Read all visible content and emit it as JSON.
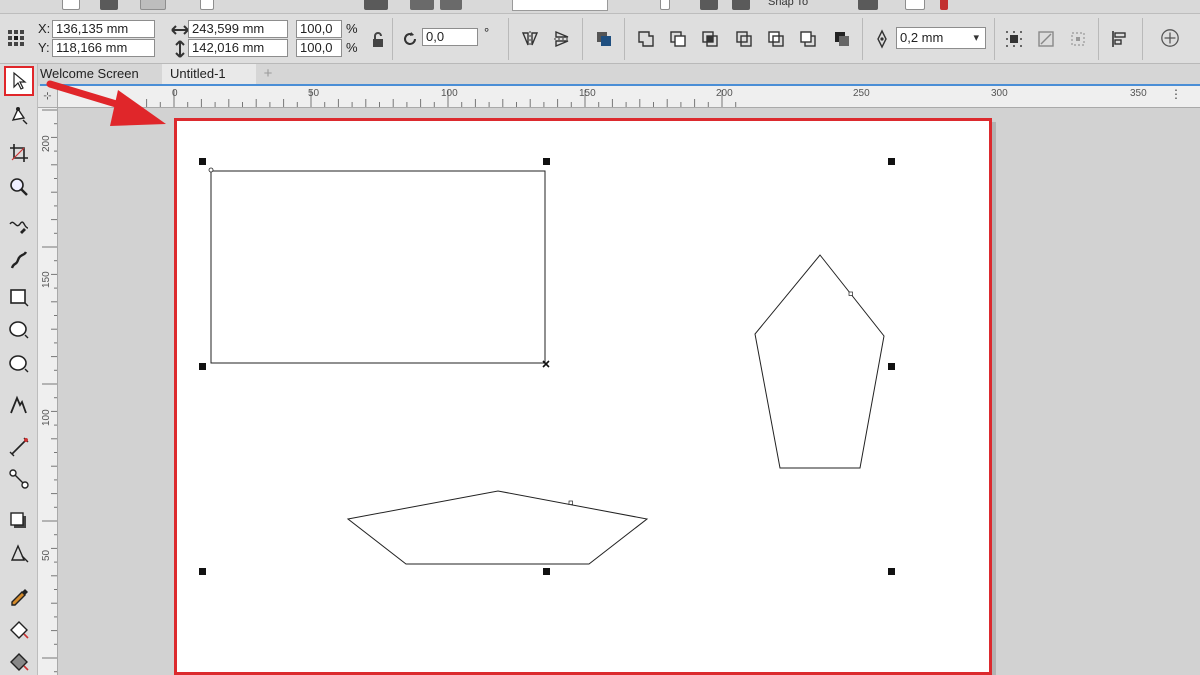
{
  "property_bar": {
    "x_label": "X:",
    "x_value": "136,135 mm",
    "y_label": "Y:",
    "y_value": "118,166 mm",
    "width_value": "243,599 mm",
    "height_value": "142,016 mm",
    "scale_x": "100,0",
    "scale_y": "100,0",
    "percent_sign_1": "%",
    "percent_sign_2": "%",
    "rotation_value": "0,0",
    "degree_sign": "°",
    "outline_width": "0,2 mm"
  },
  "top_strip": {
    "snap_label": "Snap To"
  },
  "tabs": [
    {
      "label": "Welcome Screen"
    },
    {
      "label": "Untitled-1"
    }
  ],
  "tab_add_label": "+",
  "ruler_corner_glyph": "⊹",
  "horizontal_ruler": [
    "0",
    "50",
    "100",
    "150",
    "200",
    "250",
    "300",
    "350"
  ],
  "vertical_ruler": [
    "200",
    "150",
    "100",
    "50"
  ],
  "toolbox": [
    {
      "name": "pick-tool-icon",
      "selected": true
    },
    {
      "name": "shape-tool-icon"
    },
    {
      "name": "crop-tool-icon"
    },
    {
      "name": "zoom-tool-icon"
    },
    {
      "name": "freehand-tool-icon"
    },
    {
      "name": "artistic-media-tool-icon"
    },
    {
      "name": "rectangle-tool-icon"
    },
    {
      "name": "ellipse-tool-icon"
    },
    {
      "name": "polygon-tool-icon"
    },
    {
      "name": "text-tool-icon"
    },
    {
      "name": "parallel-dimension-tool-icon"
    },
    {
      "name": "connector-tool-icon"
    },
    {
      "name": "drop-shadow-tool-icon"
    },
    {
      "name": "transparency-tool-icon"
    },
    {
      "name": "color-eyedropper-tool-icon"
    },
    {
      "name": "interactive-fill-tool-icon"
    },
    {
      "name": "smart-fill-tool-icon"
    }
  ],
  "colors": {
    "page_border": "#dc2a2e",
    "annotation_arrow": "#e0262a",
    "tab_underline": "#4a8ed6"
  }
}
